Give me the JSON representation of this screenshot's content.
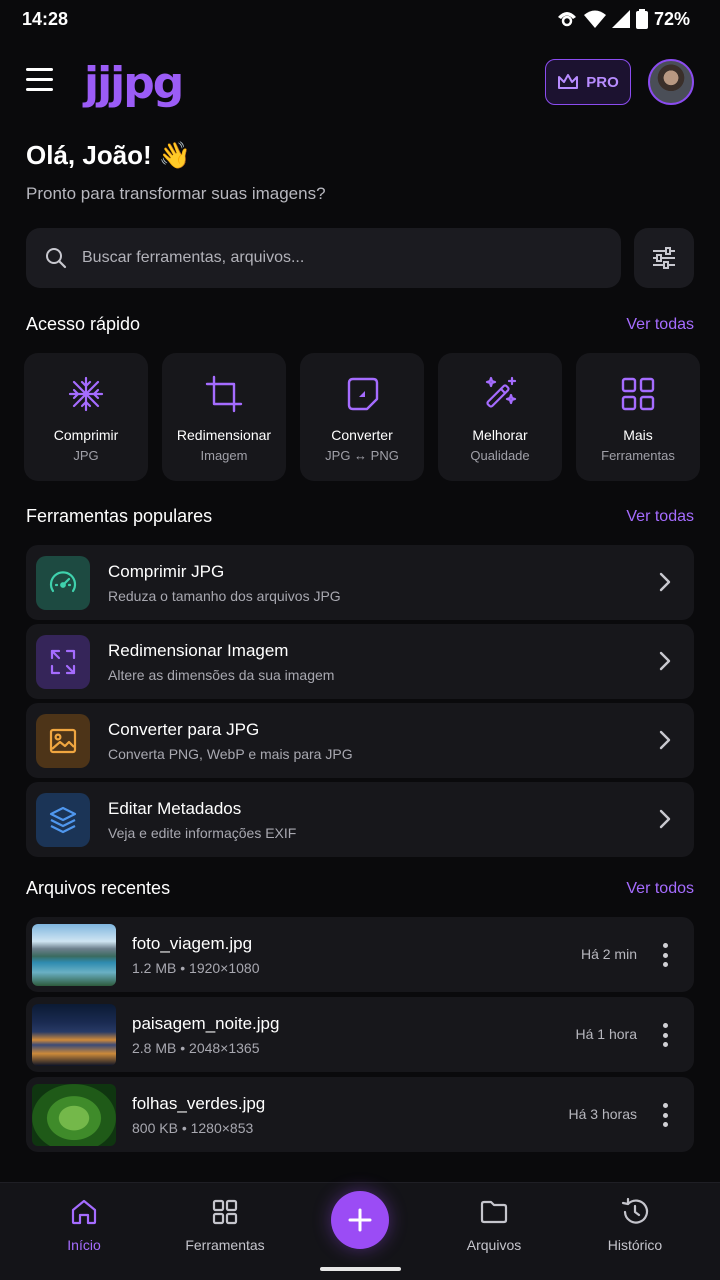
{
  "status": {
    "time": "14:28",
    "battery": "72%"
  },
  "header": {
    "logo": "jjjpg",
    "pro_label": "PRO"
  },
  "greeting": {
    "title": "Olá, João! 👋",
    "subtitle": "Pronto para transformar suas imagens?"
  },
  "search": {
    "placeholder": "Buscar ferramentas, arquivos..."
  },
  "quick_access": {
    "title": "Acesso rápido",
    "see_all": "Ver todas",
    "items": [
      {
        "label": "Comprimir",
        "sub": "JPG",
        "icon": "compress-icon"
      },
      {
        "label": "Redimensionar",
        "sub": "Imagem",
        "icon": "crop-icon"
      },
      {
        "label": "Converter",
        "sub": "JPG ↔ PNG",
        "icon": "convert-icon"
      },
      {
        "label": "Melhorar",
        "sub": "Qualidade",
        "icon": "magic-wand-icon"
      },
      {
        "label": "Mais",
        "sub": "Ferramentas",
        "icon": "grid-icon"
      }
    ]
  },
  "popular_tools": {
    "title": "Ferramentas populares",
    "see_all": "Ver todas",
    "items": [
      {
        "title": "Comprimir JPG",
        "desc": "Reduza o tamanho dos arquivos JPG",
        "icon": "speedometer-icon",
        "color": "#2fb89a"
      },
      {
        "title": "Redimensionar Imagem",
        "desc": "Altere as dimensões da sua imagem",
        "icon": "expand-icon",
        "color": "#9b5cf6"
      },
      {
        "title": "Converter para JPG",
        "desc": "Converta PNG, WebP e mais para JPG",
        "icon": "image-icon",
        "color": "#e69a3a"
      },
      {
        "title": "Editar Metadados",
        "desc": "Veja e edite informações EXIF",
        "icon": "layers-icon",
        "color": "#4a8fe0"
      }
    ]
  },
  "recent_files": {
    "title": "Arquivos recentes",
    "see_all": "Ver todos",
    "items": [
      {
        "name": "foto_viagem.jpg",
        "meta": "1.2 MB • 1920×1080",
        "time": "Há 2 min"
      },
      {
        "name": "paisagem_noite.jpg",
        "meta": "2.8 MB • 2048×1365",
        "time": "Há 1 hora"
      },
      {
        "name": "folhas_verdes.jpg",
        "meta": "800 KB • 1280×853",
        "time": "Há 3 horas"
      }
    ]
  },
  "nav": {
    "home": "Início",
    "tools": "Ferramentas",
    "files": "Arquivos",
    "history": "Histórico"
  },
  "colors": {
    "accent": "#9b4cf5",
    "background": "#0a0a0c",
    "card": "#17171b"
  }
}
